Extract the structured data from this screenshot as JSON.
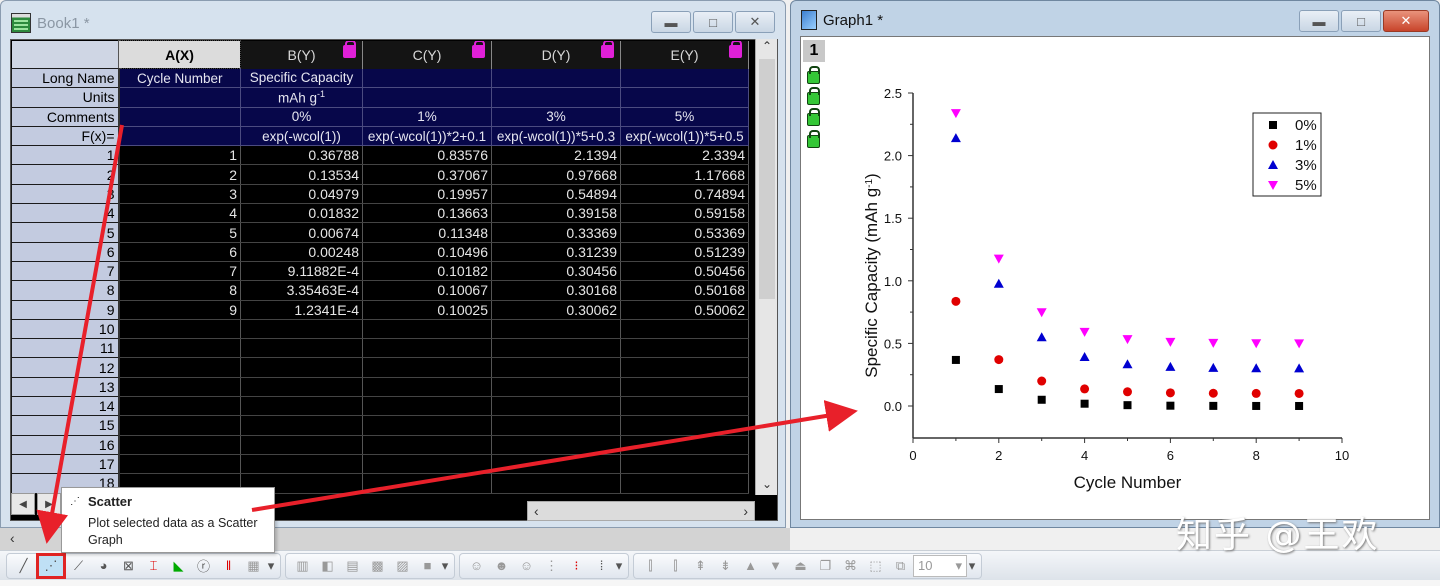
{
  "book": {
    "title": "Book1 *",
    "columns": [
      {
        "name": "A(X)",
        "long_name": "Cycle Number",
        "units": "",
        "comments": "",
        "fx": ""
      },
      {
        "name": "B(Y)",
        "long_name": "Specific Capacity",
        "units": "mAh g",
        "units_sup": "-1",
        "comments": "0%",
        "fx": "exp(-wcol(1))"
      },
      {
        "name": "C(Y)",
        "long_name": "",
        "units": "",
        "comments": "1%",
        "fx": "exp(-wcol(1))*2+0.1"
      },
      {
        "name": "D(Y)",
        "long_name": "",
        "units": "",
        "comments": "3%",
        "fx": "exp(-wcol(1))*5+0.3"
      },
      {
        "name": "E(Y)",
        "long_name": "",
        "units": "",
        "comments": "5%",
        "fx": "exp(-wcol(1))*5+0.5"
      }
    ],
    "meta_labels": [
      "Long Name",
      "Units",
      "Comments",
      "F(x)="
    ],
    "rows": [
      [
        "1",
        "1",
        "0.36788",
        "0.83576",
        "2.1394",
        "2.3394"
      ],
      [
        "2",
        "2",
        "0.13534",
        "0.37067",
        "0.97668",
        "1.17668"
      ],
      [
        "3",
        "3",
        "0.04979",
        "0.19957",
        "0.54894",
        "0.74894"
      ],
      [
        "4",
        "4",
        "0.01832",
        "0.13663",
        "0.39158",
        "0.59158"
      ],
      [
        "5",
        "5",
        "0.00674",
        "0.11348",
        "0.33369",
        "0.53369"
      ],
      [
        "6",
        "6",
        "0.00248",
        "0.10496",
        "0.31239",
        "0.51239"
      ],
      [
        "7",
        "7",
        "9.11882E-4",
        "0.10182",
        "0.30456",
        "0.50456"
      ],
      [
        "8",
        "8",
        "3.35463E-4",
        "0.10067",
        "0.30168",
        "0.50168"
      ],
      [
        "9",
        "9",
        "1.2341E-4",
        "0.10025",
        "0.30062",
        "0.50062"
      ],
      [
        "10",
        "",
        "",
        "",
        "",
        ""
      ],
      [
        "11",
        "",
        "",
        "",
        "",
        ""
      ],
      [
        "12",
        "",
        "",
        "",
        "",
        ""
      ],
      [
        "13",
        "",
        "",
        "",
        "",
        ""
      ],
      [
        "14",
        "",
        "",
        "",
        "",
        ""
      ],
      [
        "15",
        "",
        "",
        "",
        "",
        ""
      ],
      [
        "16",
        "",
        "",
        "",
        "",
        ""
      ],
      [
        "17",
        "",
        "",
        "",
        "",
        ""
      ],
      [
        "18",
        "",
        "",
        "",
        "",
        ""
      ]
    ]
  },
  "graph": {
    "title": "Graph1 *",
    "layer_label": "1"
  },
  "tooltip": {
    "title": "Scatter",
    "body": "Plot selected data as a Scatter Graph"
  },
  "toolbar": {
    "font_size_value": "10"
  },
  "watermark": "知乎 @王欢",
  "window_buttons": {
    "minimize": "▬",
    "maximize": "□",
    "close": "✕"
  },
  "chart_data": {
    "type": "scatter",
    "title": "",
    "xlabel": "Cycle Number",
    "ylabel": "Specific Capacity (mAh g-1)",
    "xlim": [
      0,
      10
    ],
    "ylim": [
      -0.1,
      2.5
    ],
    "xticks": [
      0,
      2,
      4,
      6,
      8,
      10
    ],
    "yticks": [
      0.0,
      0.5,
      1.0,
      1.5,
      2.0,
      2.5
    ],
    "ytick_labels": [
      "0.0",
      "0.5",
      "1.0",
      "1.5",
      "2.0",
      "2.5"
    ],
    "legend_position": "top-right",
    "x": [
      1,
      2,
      3,
      4,
      5,
      6,
      7,
      8,
      9
    ],
    "series": [
      {
        "name": "0%",
        "color": "#000000",
        "marker": "square",
        "values": [
          0.36788,
          0.13534,
          0.04979,
          0.01832,
          0.00674,
          0.00248,
          0.000912,
          0.000335,
          0.000123
        ]
      },
      {
        "name": "1%",
        "color": "#e00000",
        "marker": "circle",
        "values": [
          0.83576,
          0.37067,
          0.19957,
          0.13663,
          0.11348,
          0.10496,
          0.10182,
          0.10067,
          0.10025
        ]
      },
      {
        "name": "3%",
        "color": "#0000d0",
        "marker": "triangle-up",
        "values": [
          2.1394,
          0.97668,
          0.54894,
          0.39158,
          0.33369,
          0.31239,
          0.30456,
          0.30168,
          0.30062
        ]
      },
      {
        "name": "5%",
        "color": "#ff00ff",
        "marker": "triangle-down",
        "values": [
          2.3394,
          1.17668,
          0.74894,
          0.59158,
          0.53369,
          0.51239,
          0.50456,
          0.50168,
          0.50062
        ]
      }
    ]
  }
}
